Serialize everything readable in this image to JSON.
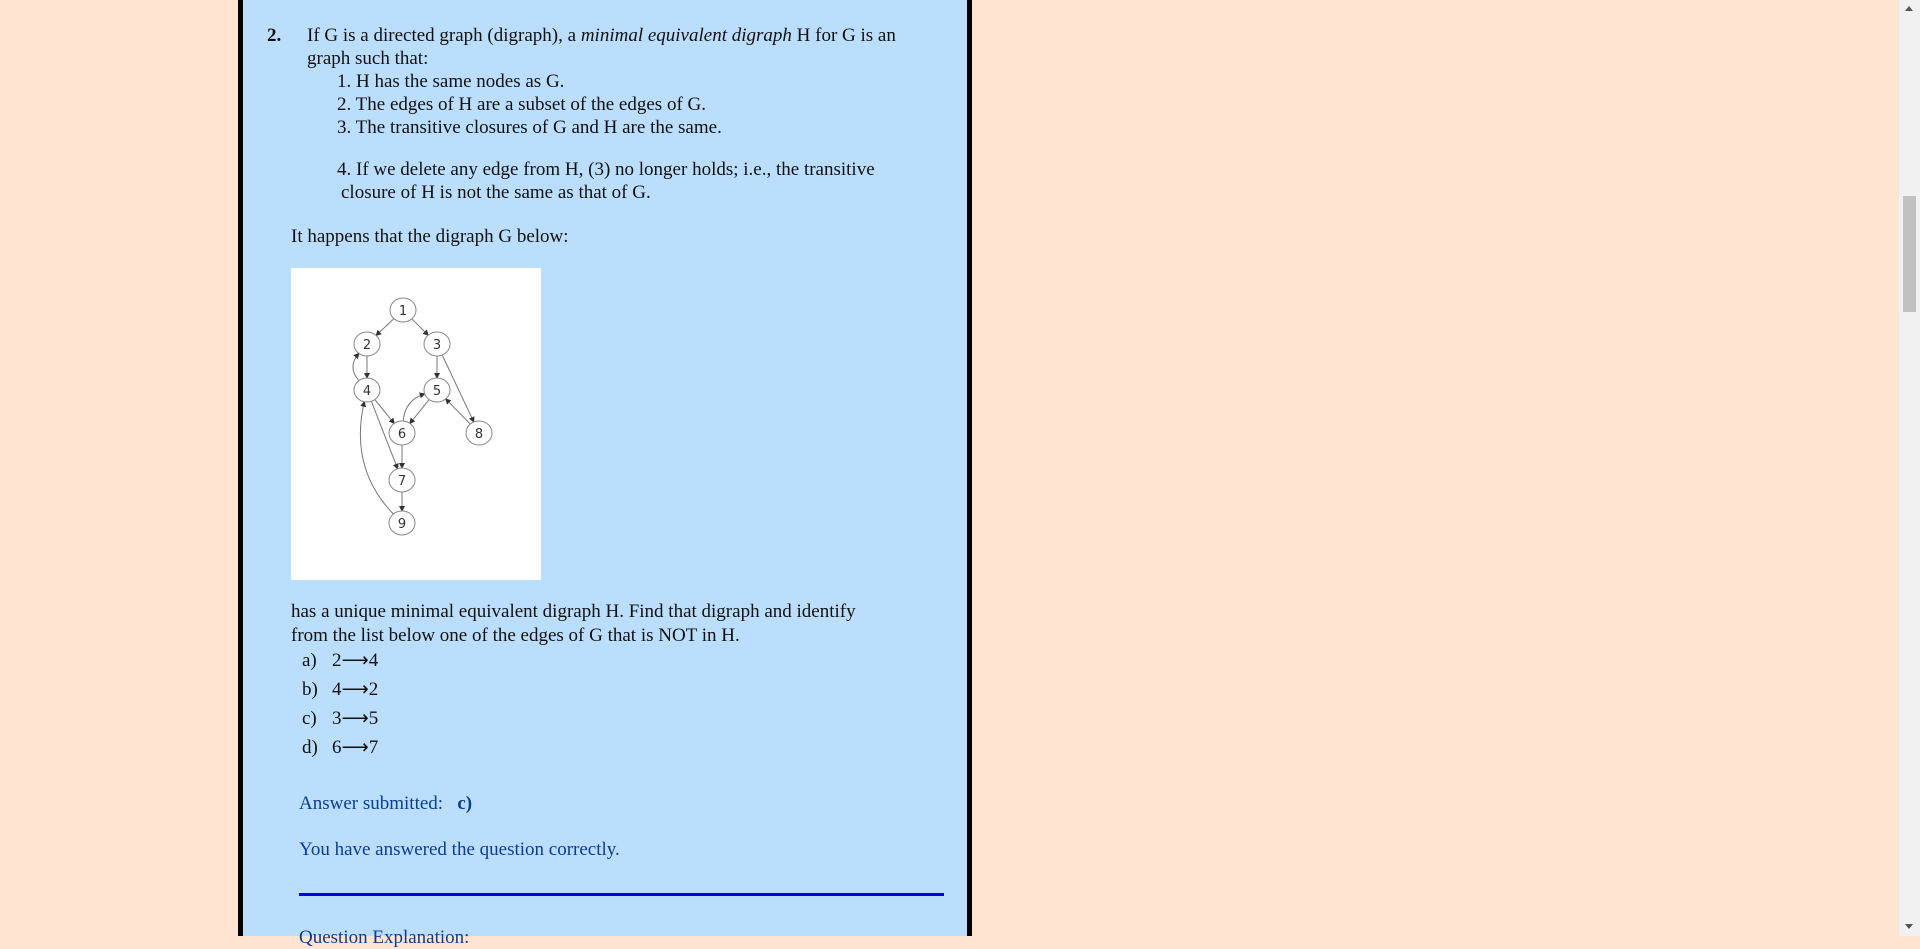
{
  "question": {
    "number": "2.",
    "stem_line1_before": "If G is a directed graph (digraph), a ",
    "stem_line1_italic": "minimal equivalent digraph",
    "stem_line1_after": " H for G is an",
    "stem_line2": "graph such that:",
    "conditions": [
      {
        "num": "1.",
        "text": "H has the same nodes as G."
      },
      {
        "num": "2.",
        "text": "The edges of H are a subset of the edges of G."
      },
      {
        "num": "3.",
        "text": "The transitive closures of G and H are the same."
      },
      {
        "num": "4.",
        "text": "If we delete any edge from H, (3) no longer holds; i.e., the transitive",
        "cont": "closure of H is not the same as that of G."
      }
    ],
    "lead_in": "It happens that the digraph G below:",
    "follow_line1": "has a unique minimal equivalent digraph H. Find that digraph and identify",
    "follow_line2": "from the list below one of the edges of G that is NOT in H.",
    "options": [
      {
        "key": "a)",
        "text": "2⟶4"
      },
      {
        "key": "b)",
        "text": "4⟶2"
      },
      {
        "key": "c)",
        "text": "3⟶5"
      },
      {
        "key": "d)",
        "text": "6⟶7"
      }
    ]
  },
  "graph": {
    "nodes": [
      "1",
      "2",
      "3",
      "4",
      "5",
      "6",
      "7",
      "8",
      "9"
    ],
    "edges": [
      [
        "1",
        "2"
      ],
      [
        "1",
        "3"
      ],
      [
        "2",
        "4"
      ],
      [
        "4",
        "2"
      ],
      [
        "3",
        "5"
      ],
      [
        "3",
        "8"
      ],
      [
        "8",
        "5"
      ],
      [
        "5",
        "6"
      ],
      [
        "6",
        "5"
      ],
      [
        "4",
        "6"
      ],
      [
        "4",
        "7"
      ],
      [
        "6",
        "7"
      ],
      [
        "7",
        "9"
      ],
      [
        "9",
        "4"
      ]
    ]
  },
  "feedback": {
    "answer_label": "Answer submitted:",
    "answer_value": "c)",
    "result": "You have answered the question correctly.",
    "next_heading": "Question Explanation:"
  },
  "colors": {
    "page_bg": "#ffe4d2",
    "panel_bg": "#bbdefd",
    "feedback_text": "#0a3d91",
    "rule": "#0000ee"
  }
}
